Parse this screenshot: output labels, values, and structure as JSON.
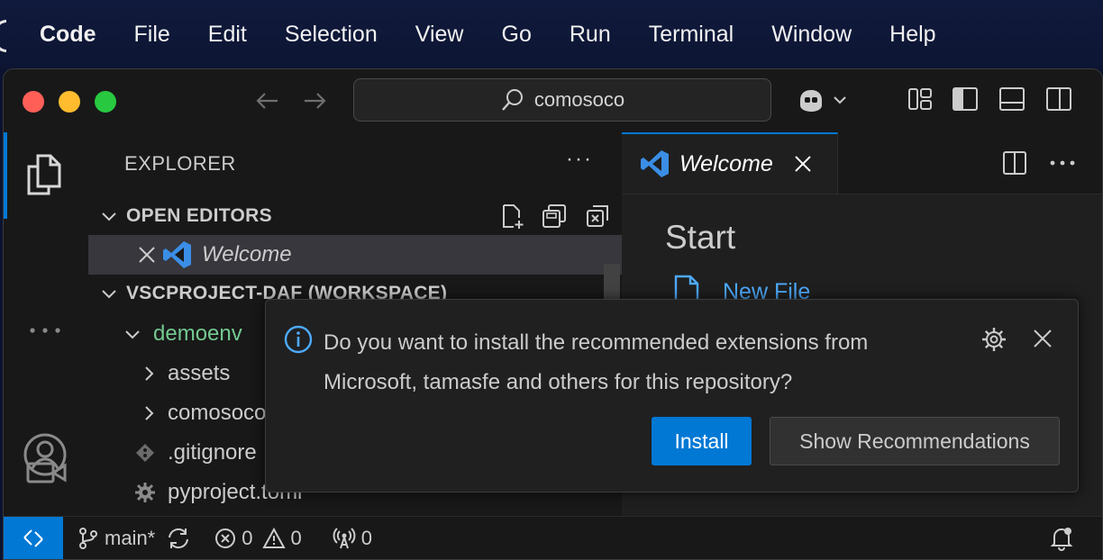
{
  "menubar": {
    "app": "Code",
    "items": [
      "File",
      "Edit",
      "Selection",
      "View",
      "Go",
      "Run",
      "Terminal",
      "Window",
      "Help"
    ]
  },
  "titlebar": {
    "search_text": "comosoco"
  },
  "sidebar": {
    "title": "EXPLORER",
    "more": "···",
    "open_editors": {
      "label": "OPEN EDITORS",
      "items": [
        {
          "name": "Welcome"
        }
      ]
    },
    "workspace": {
      "label": "VSCPROJECT-DAF (WORKSPACE)",
      "folder": "demoenv",
      "children": [
        "assets",
        "comosoco",
        ".gitignore",
        "pyproject.toml"
      ]
    }
  },
  "editor": {
    "tab_label": "Welcome",
    "start_heading": "Start",
    "new_file": "New File"
  },
  "notification": {
    "message_line1": "Do you want to install the recommended extensions from",
    "message_line2": "Microsoft, tamasfe and others for this repository?",
    "install_label": "Install",
    "show_recommendations_label": "Show Recommendations"
  },
  "statusbar": {
    "branch": "main*",
    "errors": "0",
    "warnings": "0",
    "ports": "0"
  },
  "colors": {
    "accent": "#0078d4",
    "folder_green": "#73c991",
    "link": "#4daafc"
  }
}
